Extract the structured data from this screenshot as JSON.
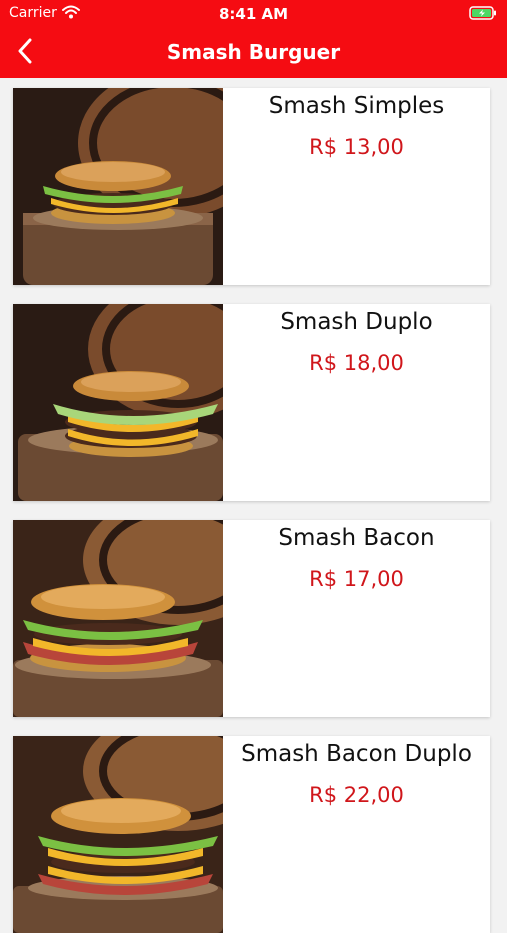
{
  "status_bar": {
    "carrier": "Carrier",
    "time": "8:41 AM",
    "icons": [
      "wifi-icon",
      "battery-charging-icon"
    ]
  },
  "nav": {
    "title": "Smash Burguer",
    "back_icon": "chevron-left-icon"
  },
  "colors": {
    "brand_red": "#f50c12",
    "price_red": "#d0161b",
    "battery_green": "#4cd964"
  },
  "products": [
    {
      "name": "Smash Simples",
      "price": "R$ 13,00"
    },
    {
      "name": "Smash Duplo",
      "price": "R$ 18,00"
    },
    {
      "name": "Smash Bacon",
      "price": "R$ 17,00"
    },
    {
      "name": "Smash Bacon Duplo",
      "price": "R$ 22,00"
    }
  ]
}
